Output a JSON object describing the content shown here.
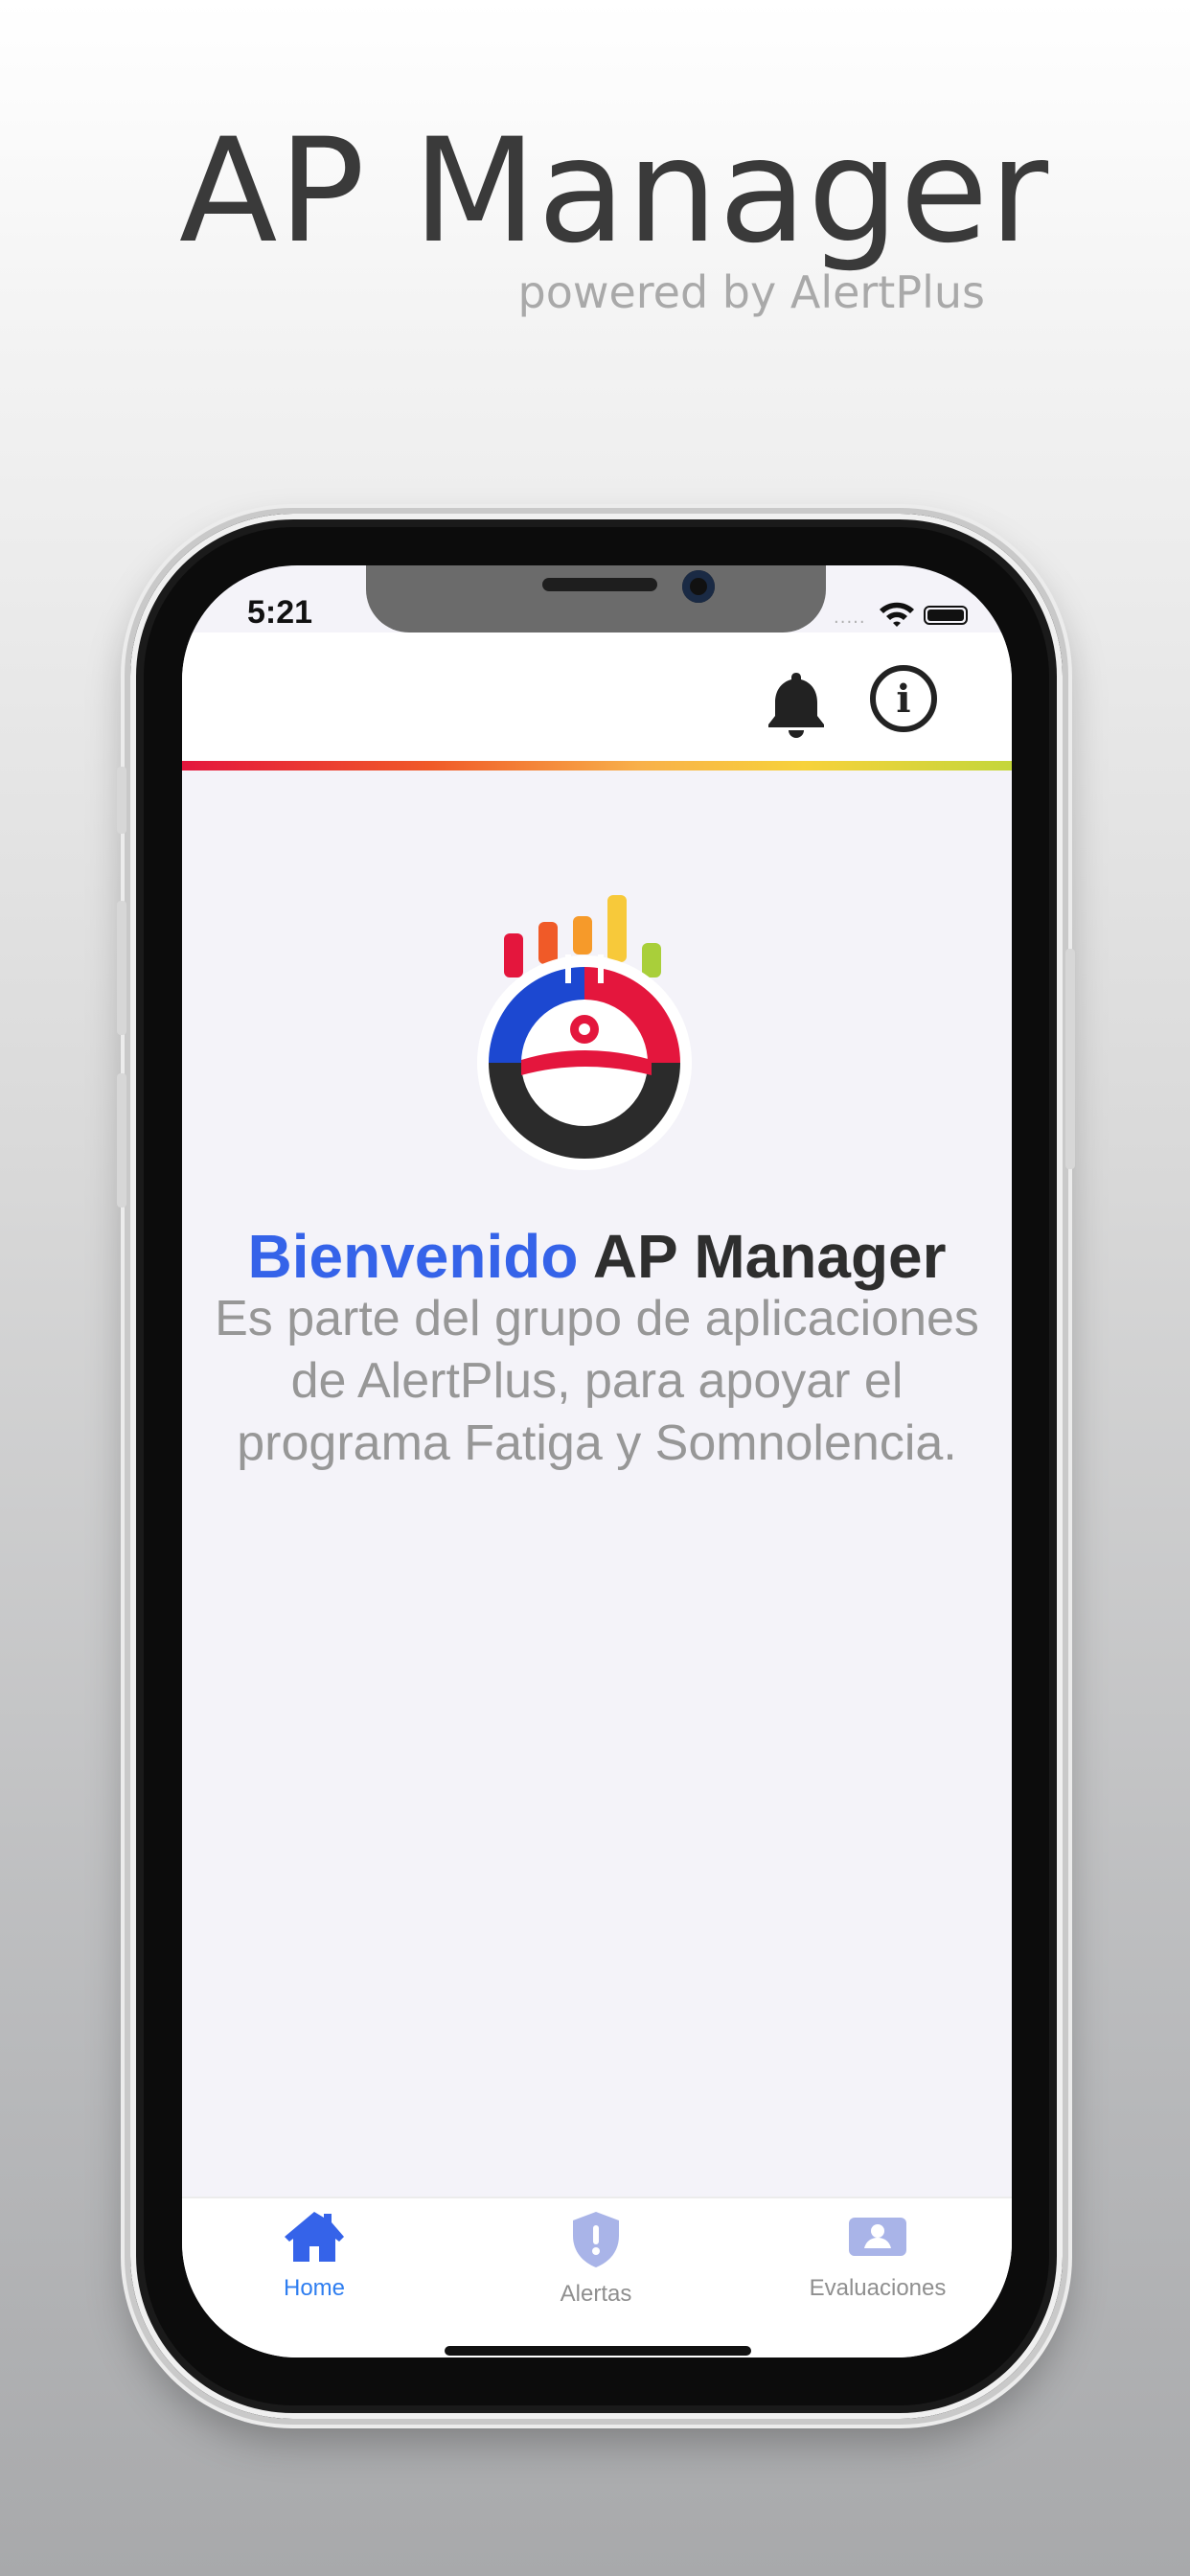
{
  "promo": {
    "title": "AP Manager",
    "subtitle": "powered by AlertPlus"
  },
  "status_bar": {
    "time": "5:21",
    "signal": "....."
  },
  "header": {
    "bell_icon": "bell-icon",
    "info_icon": "info-icon",
    "info_glyph": "i"
  },
  "welcome": {
    "highlight": "Bienvenido",
    "rest": " AP Manager",
    "description": "Es parte del grupo de aplicaciones de AlertPlus, para apoyar el programa Fatiga y Somnolencia."
  },
  "tabs": [
    {
      "label": "Home",
      "icon": "home-icon",
      "active": true
    },
    {
      "label": "Alertas",
      "icon": "shield-alert-icon",
      "active": false
    },
    {
      "label": "Evaluaciones",
      "icon": "id-card-icon",
      "active": false
    }
  ],
  "colors": {
    "accent": "#3563e9",
    "active_tab": "#2f7ef0",
    "inactive_icon": "#a9b4e8"
  }
}
